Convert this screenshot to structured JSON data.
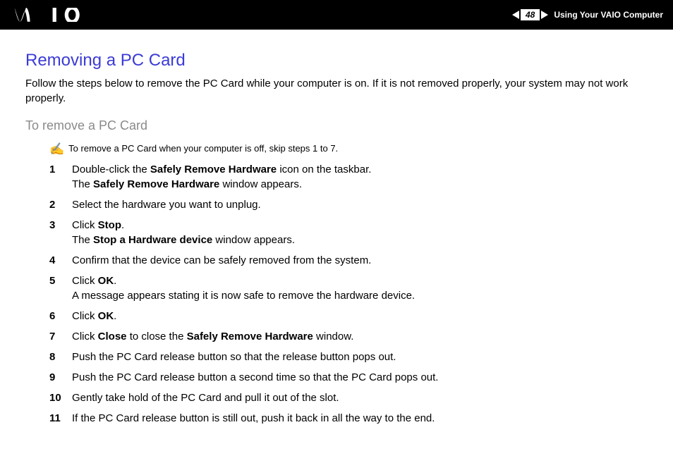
{
  "header": {
    "page_number": "48",
    "section_title": "Using Your VAIO Computer"
  },
  "title": "Removing a PC Card",
  "intro": "Follow the steps below to remove the PC Card while your computer is on. If it is not removed properly, your system may not work properly.",
  "subtitle": "To remove a PC Card",
  "note": "To remove a PC Card when your computer is off, skip steps 1 to 7.",
  "steps": [
    "Double-click the <b>Safely Remove Hardware</b> icon on the taskbar.<br>The <b>Safely Remove Hardware</b> window appears.",
    "Select the hardware you want to unplug.",
    "Click <b>Stop</b>.<br>The <b>Stop a Hardware device</b> window appears.",
    "Confirm that the device can be safely removed from the system.",
    "Click <b>OK</b>.<br>A message appears stating it is now safe to remove the hardware device.",
    "Click <b>OK</b>.",
    "Click <b>Close</b> to close the <b>Safely Remove Hardware</b> window.",
    "Push the PC Card release button so that the release button pops out.",
    "Push the PC Card release button a second time so that the PC Card pops out.",
    "Gently take hold of the PC Card and pull it out of the slot.",
    "If the PC Card release button is still out, push it back in all the way to the end."
  ]
}
